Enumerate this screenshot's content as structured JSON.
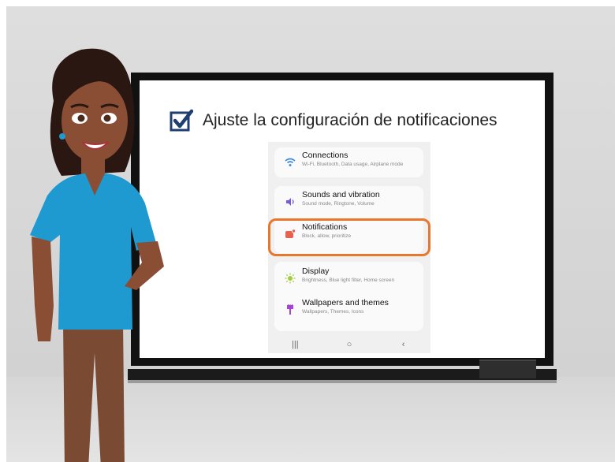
{
  "slide": {
    "title": "Ajuste la configuración de notificaciones",
    "title_icon": "checkbox-checked-icon"
  },
  "settings_list": [
    {
      "label": "Connections",
      "sub": "Wi-Fi, Bluetooth, Data usage, Airplane mode",
      "icon": "wifi-icon",
      "color": "#3d8bd9"
    },
    {
      "label": "Sounds and vibration",
      "sub": "Sound mode, Ringtone, Volume",
      "icon": "volume-icon",
      "color": "#7a5bd6"
    },
    {
      "label": "Notifications",
      "sub": "Block, allow, prioritize",
      "icon": "notification-icon",
      "color": "#e8614f"
    },
    {
      "label": "Display",
      "sub": "Brightness, Blue light filter, Home screen",
      "icon": "sun-icon",
      "color": "#9fcf3a"
    },
    {
      "label": "Wallpapers and themes",
      "sub": "Wallpapers, Themes, Icons",
      "icon": "brush-icon",
      "color": "#a744d6"
    }
  ],
  "highlight_color": "#e8762c",
  "navbar": {
    "recents": "|||",
    "home": "○",
    "back": "‹"
  }
}
